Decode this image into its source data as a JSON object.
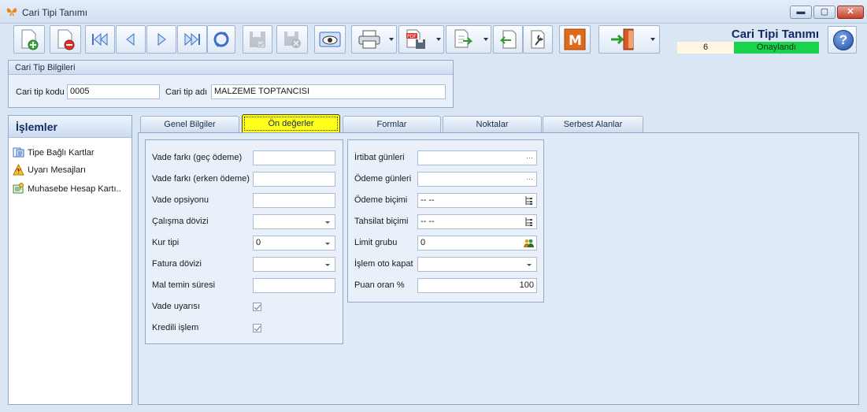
{
  "window": {
    "title": "Cari Tipi Tanımı",
    "min": "▬",
    "max": "▢",
    "close": "✕"
  },
  "toolbar": {
    "buttons": [
      {
        "name": "new-record-button"
      },
      {
        "name": "delete-record-button"
      },
      {
        "name": "first-record-button"
      },
      {
        "name": "prev-record-button"
      },
      {
        "name": "next-record-button"
      },
      {
        "name": "last-record-button"
      },
      {
        "name": "refresh-button"
      },
      {
        "name": "save-button"
      },
      {
        "name": "save-close-button"
      },
      {
        "name": "preview-button"
      },
      {
        "name": "print-button"
      },
      {
        "name": "pdf-export-button"
      },
      {
        "name": "export-button"
      },
      {
        "name": "import-button"
      },
      {
        "name": "tools-button"
      },
      {
        "name": "m-button"
      },
      {
        "name": "exit-button"
      }
    ],
    "m_label": "M"
  },
  "header": {
    "title": "Cari Tipi Tanımı",
    "number": "6",
    "status": "Onaylandı",
    "help": "?"
  },
  "info_group": {
    "title": "Cari Tip Bilgileri",
    "code_label": "Cari tip kodu",
    "code_value": "0005",
    "name_label": "Cari tip adı",
    "name_value": "MALZEME TOPTANCISI"
  },
  "side": {
    "title": "İşlemler",
    "items": [
      {
        "label": "Tipe Bağlı Kartlar",
        "icon": "cards-icon"
      },
      {
        "label": "Uyarı Mesajları",
        "icon": "warning-icon"
      },
      {
        "label": "Muhasebe Hesap Kartı..",
        "icon": "accounting-icon"
      }
    ]
  },
  "tabs": [
    {
      "label": "Genel Bilgiler"
    },
    {
      "label": "Ön değerler"
    },
    {
      "label": "Formlar"
    },
    {
      "label": "Noktalar"
    },
    {
      "label": "Serbest Alanlar"
    }
  ],
  "left_fields": [
    {
      "label": "Vade farkı (geç ödeme)",
      "value": "",
      "type": "text"
    },
    {
      "label": "Vade farkı (erken ödeme)",
      "value": "",
      "type": "text"
    },
    {
      "label": "Vade opsiyonu",
      "value": "",
      "type": "text"
    },
    {
      "label": "Çalışma dövizi",
      "value": "",
      "type": "combo"
    },
    {
      "label": "Kur tipi",
      "value": "0",
      "type": "combo"
    },
    {
      "label": "Fatura dövizi",
      "value": "",
      "type": "combo"
    },
    {
      "label": "Mal temin süresi",
      "value": "",
      "type": "text"
    },
    {
      "label": "Vade uyarısı",
      "checked": true,
      "type": "check"
    },
    {
      "label": "Kredili işlem",
      "checked": true,
      "type": "check"
    }
  ],
  "right_fields": [
    {
      "label": "İrtibat günleri",
      "value": "",
      "type": "ellipsis",
      "button": "···"
    },
    {
      "label": "Ödeme günleri",
      "value": "",
      "type": "ellipsis",
      "button": "···"
    },
    {
      "label": "Ödeme biçimi",
      "value": "-- --",
      "type": "tree"
    },
    {
      "label": "Tahsilat biçimi",
      "value": "-- --",
      "type": "tree"
    },
    {
      "label": "Limit grubu",
      "value": "0",
      "type": "people"
    },
    {
      "label": "İşlem oto kapat",
      "value": "",
      "type": "combo"
    },
    {
      "label": "Puan oran %",
      "value": "100",
      "type": "number"
    }
  ],
  "colors": {
    "accent": "#0f2a5e",
    "status_green": "#19d34c",
    "active_tab": "#ffff1a"
  }
}
